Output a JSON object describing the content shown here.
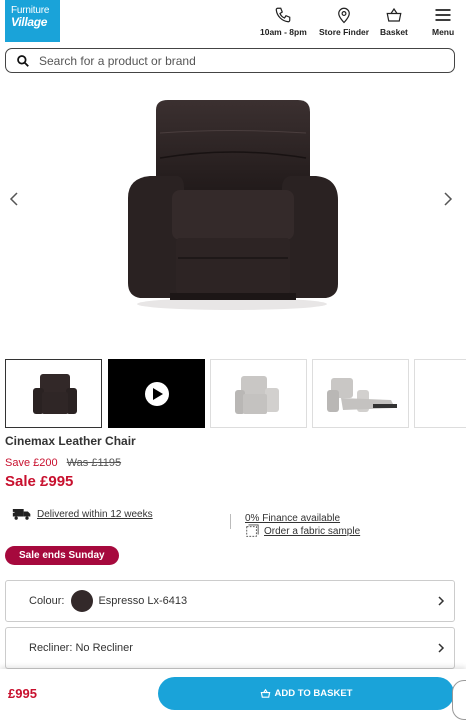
{
  "header": {
    "logo_line1": "Furniture",
    "logo_line2": "Village",
    "hours_label": "10am - 8pm",
    "store_finder_label": "Store Finder",
    "basket_label": "Basket",
    "menu_label": "Menu"
  },
  "search": {
    "placeholder": "Search for a product or brand"
  },
  "product": {
    "name": "Cinemax Leather Chair",
    "save_text": "Save £200",
    "was_text": "Was £1195",
    "sale_price": "Sale £995"
  },
  "info": {
    "delivery": "Delivered within 12 weeks",
    "finance": "0% Finance available",
    "sample": "Order a fabric sample"
  },
  "badge": "Sale ends Sunday",
  "options": {
    "colour_label": "Colour:",
    "colour_value": "Espresso Lx-6413",
    "recliner_label": "Recliner: No Recliner"
  },
  "footer_bar": {
    "price": "£995",
    "add_to_basket": "ADD TO BASKET"
  },
  "colors": {
    "brand_blue": "#1aa3d9",
    "sale_red": "#c8102e",
    "badge": "#a6093d",
    "swatch": "#33292a"
  },
  "icons": [
    "phone-icon",
    "location-pin-icon",
    "basket-icon",
    "menu-icon",
    "search-icon",
    "delivery-truck-icon",
    "fabric-sample-icon",
    "chevron-right-icon",
    "play-icon"
  ]
}
